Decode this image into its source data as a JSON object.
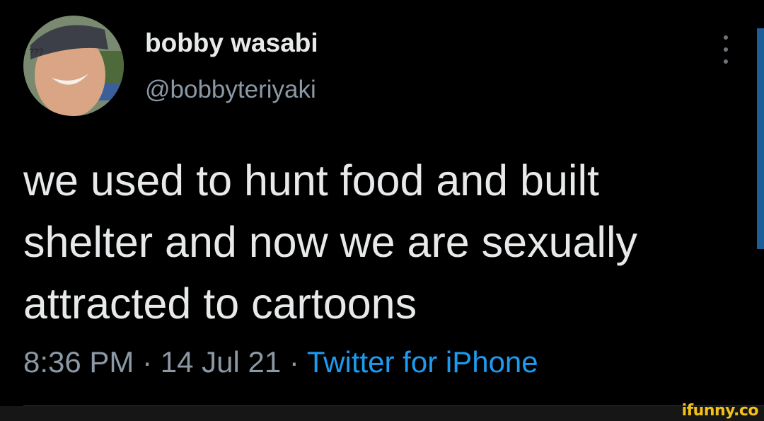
{
  "author": {
    "display_name": "bobby wasabi",
    "handle": "@bobbyteriyaki",
    "avatar_caption": "???"
  },
  "tweet": {
    "text": "we used to hunt food and built shelter and now we are sexually attracted to cartoons",
    "time": "8:36 PM",
    "separator": "·",
    "date": "14 Jul 21",
    "source": "Twitter for iPhone"
  },
  "watermark": "ifunny.co",
  "icons": {
    "more": "more-vertical-icon"
  },
  "colors": {
    "background": "#000000",
    "primary_text": "#e7e9ea",
    "secondary_text": "#8b98a5",
    "link": "#1d9bf0",
    "watermark": "#f2c218"
  }
}
